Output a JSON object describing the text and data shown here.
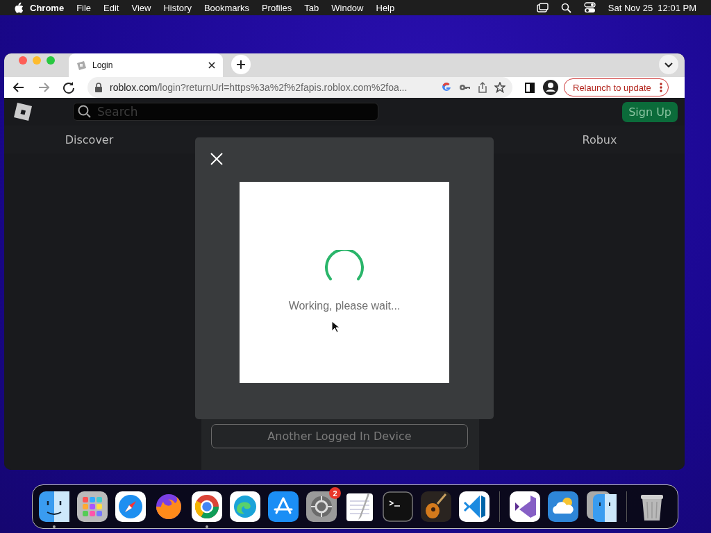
{
  "menubar": {
    "app": "Chrome",
    "menus": [
      "File",
      "Edit",
      "View",
      "History",
      "Bookmarks",
      "Profiles",
      "Tab",
      "Window",
      "Help"
    ],
    "clock": "Sat Nov 25  12:01 PM"
  },
  "browser": {
    "tab": {
      "title": "Login",
      "selected": true
    },
    "url": {
      "host": "roblox.com",
      "path": "/login?returnUrl=https%3a%2f%2fapis.roblox.com%2foa..."
    },
    "relaunch": "Relaunch to update"
  },
  "page": {
    "search": {
      "placeholder": "Search"
    },
    "sign_up": "Sign Up",
    "nav": [
      "Discover",
      "Robux"
    ],
    "modal": {
      "message": "Working, please wait..."
    },
    "device_button": "Another Logged In Device"
  },
  "dock": [
    {
      "kind": "app",
      "running": true
    },
    {
      "kind": "app",
      "running": false
    },
    {
      "kind": "app",
      "running": false
    },
    {
      "kind": "app",
      "running": false
    },
    {
      "kind": "app",
      "running": true
    },
    {
      "kind": "app",
      "running": false
    },
    {
      "kind": "app",
      "running": false
    },
    {
      "kind": "app",
      "running": false,
      "badge": "2"
    },
    {
      "kind": "app",
      "running": false
    },
    {
      "kind": "app",
      "running": false
    },
    {
      "kind": "app",
      "running": false
    },
    {
      "kind": "app",
      "running": false
    },
    {
      "kind": "separator"
    },
    {
      "kind": "app",
      "running": false
    },
    {
      "kind": "app",
      "running": false
    },
    {
      "kind": "app",
      "running": false
    },
    {
      "kind": "separator"
    },
    {
      "kind": "app",
      "running": false
    }
  ]
}
